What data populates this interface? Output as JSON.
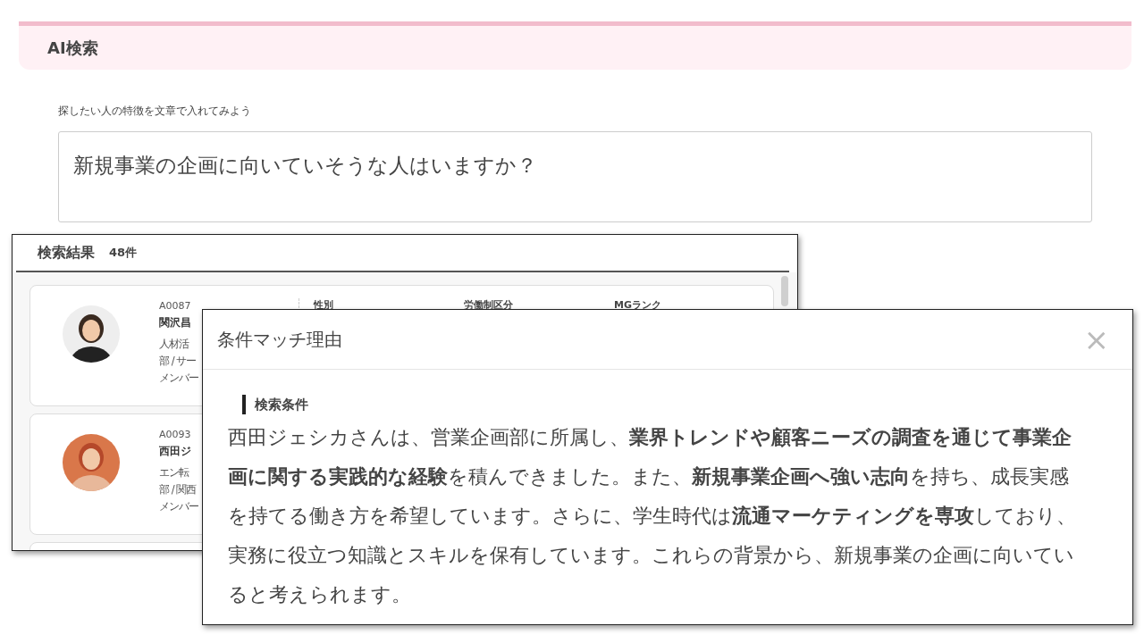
{
  "header": {
    "title": "AI検索"
  },
  "search": {
    "label": "探したい人の特徴を文章で入れてみよう",
    "value": "新規事業の企画に向いていそうな人はいますか？"
  },
  "results": {
    "title": "検索結果",
    "count": "48件",
    "columns": [
      "性別",
      "労働制区分",
      "MGランク"
    ],
    "cards": [
      {
        "code": "A0087",
        "name": "関沢昌",
        "lines": [
          "人材活",
          "部 / サー",
          "メンバー"
        ]
      },
      {
        "code": "A0093",
        "name": "西田ジ",
        "lines": [
          "エン転",
          "部 / 関西",
          "メンバー"
        ]
      }
    ]
  },
  "modal": {
    "title": "条件マッチ理由",
    "close": "×",
    "section": "検索条件",
    "text": "西田ジェシカさんは、営業企画部に所属し、**業界トレンドや顧客ニーズの調査を通じて事業企画に関する実践的な経験**を積んできました。また、**新規事業企画へ強い志向**を持ち、成長実感を持てる働き方を希望しています。さらに、学生時代は**流通マーケティングを専攻**しており、実務に役立つ知識とスキルを保有しています。これらの背景から、新規事業の企画に向いていると考えられます。"
  }
}
